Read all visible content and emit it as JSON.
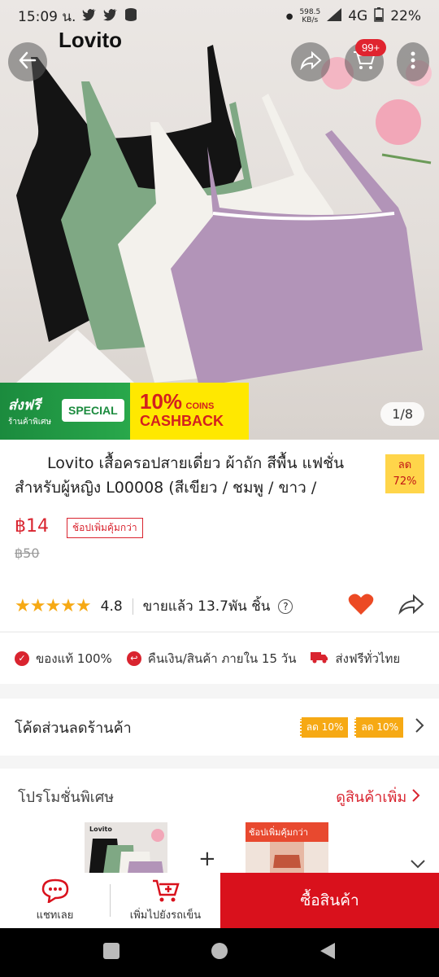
{
  "status_bar": {
    "time": "15:09 น.",
    "net_speed": "598.5",
    "net_unit": "KB/s",
    "signal": "4G",
    "battery": "22%"
  },
  "header": {
    "brand": "Lovito",
    "cart_badge": "99+"
  },
  "hero": {
    "page_indicator": "1/8",
    "banner_free_title": "ส่งฟรี",
    "banner_free_sub": "ร้านค้าพิเศษ",
    "banner_special": "SPECIAL",
    "banner_cashback_pct": "10%",
    "banner_coins": "COINS",
    "banner_cashback": "CASHBACK"
  },
  "product": {
    "title": "Lovito เสื้อครอปสายเดี่ยว ผ้าถัก สีพื้น แฟชั่น สำหรับผู้หญิง L00008 (สีเขียว / ชมพู / ขาว /",
    "discount_label": "ลด",
    "discount_pct": "72%",
    "price": "฿14",
    "bundle_tag": "ช้อปเพิ่มคุ้มกว่า",
    "old_price": "฿50",
    "rating": "4.8",
    "sold": "ขายแล้ว 13.7พัน ชิ้น",
    "help_icon_text": "?"
  },
  "guarantees": [
    {
      "label": "ของแท้ 100%"
    },
    {
      "label": "คืนเงิน/สินค้า ภายใน 15 วัน"
    },
    {
      "label": "ส่งฟรีทั่วไทย"
    }
  ],
  "coupon": {
    "label": "โค้ดส่วนลดร้านค้า",
    "chips": [
      "ลด 10%",
      "ลด 10%"
    ]
  },
  "promo": {
    "title": "โปรโมชั่นพิเศษ",
    "more": "ดูสินค้าเพิ่ม",
    "thumb_brand": "Lovito",
    "thumb2_label": "ช้อปเพิ่มคุ้มกว่า",
    "plus": "+"
  },
  "bottom_bar": {
    "chat": "แชทเลย",
    "add_to_cart": "เพิ่มไปยังรถเข็น",
    "buy": "ซื้อสินค้า"
  },
  "colors": {
    "accent": "#d9111c",
    "rating_star": "#f6a914",
    "price": "#d9242f"
  }
}
